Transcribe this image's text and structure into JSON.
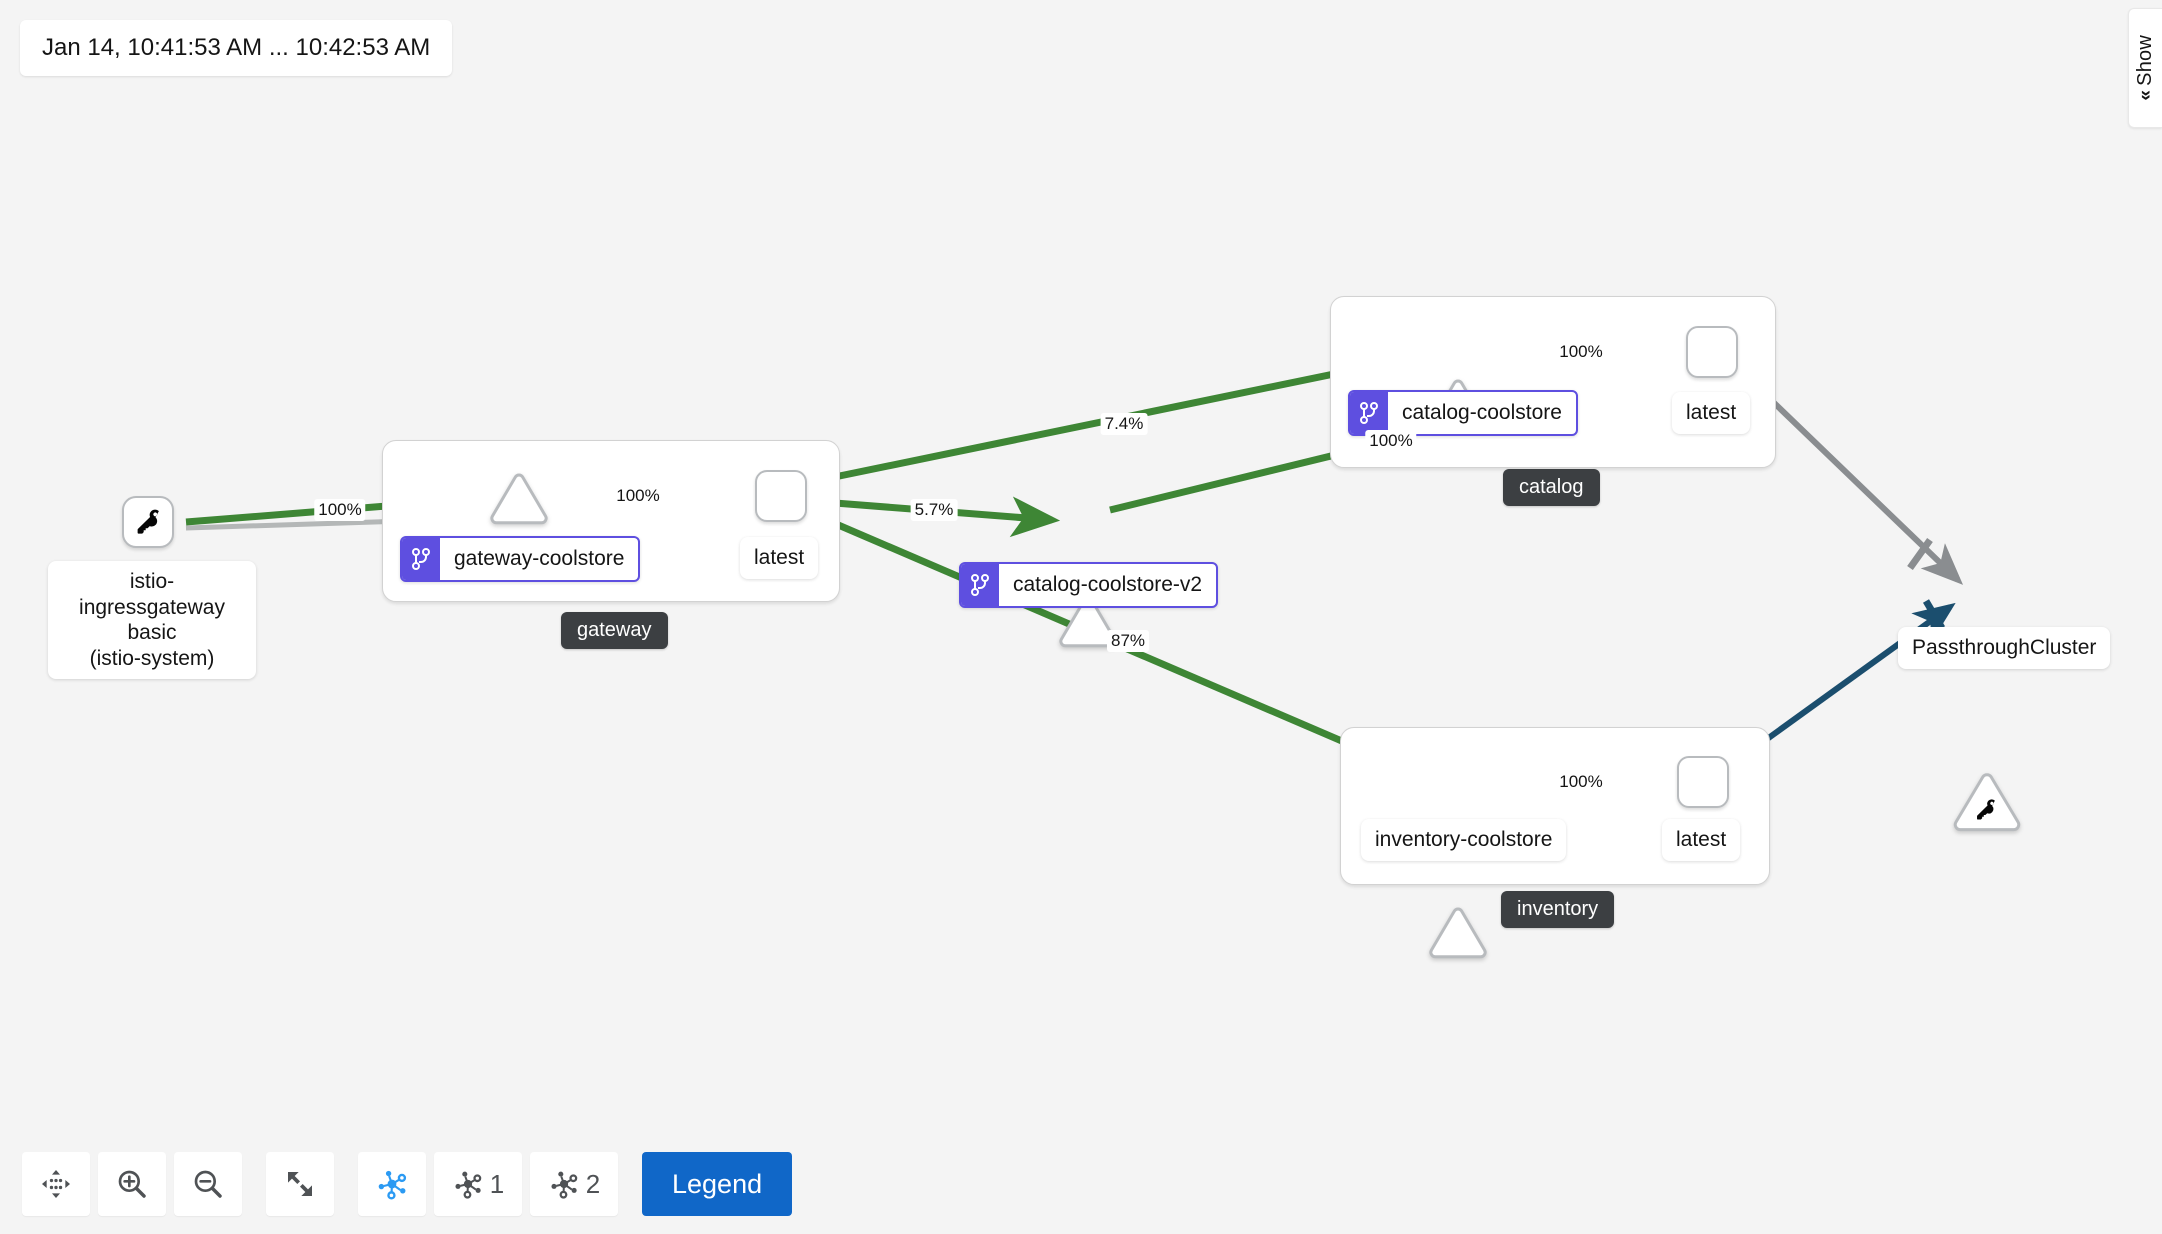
{
  "time_range": {
    "label": "Jan 14, 10:41:53 AM ... 10:42:53 AM"
  },
  "side_panel": {
    "show_label": "Show",
    "chevron": "«",
    "chevron_icon": "double-chevron-left-icon"
  },
  "colors": {
    "healthy_edge": "#3e8635",
    "idle_edge": "#8a8d90",
    "tcp_edge": "#1b4e6e",
    "badge_purple": "#5e4fe0",
    "group_badge_bg": "#3c3f42",
    "legend_blue": "#1067c8",
    "node_border": "#b8bbbe",
    "canvas_bg": "#f4f4f4",
    "active_toolbar_icon": "#2b9af3"
  },
  "groups": [
    {
      "id": "gateway",
      "label": "gateway"
    },
    {
      "id": "catalog",
      "label": "catalog"
    },
    {
      "id": "inventory",
      "label": "inventory"
    }
  ],
  "nodes": [
    {
      "id": "ingress",
      "type": "key-square",
      "icon": "key-icon",
      "label": "istio-ingressgateway\nbasic\n(istio-system)",
      "label_lines": [
        "istio-ingressgateway",
        "basic",
        "(istio-system)"
      ],
      "group": null
    },
    {
      "id": "gw-svc",
      "type": "service-triangle",
      "label": "gateway-coolstore",
      "badged": true,
      "badge_icon": "code-branch-icon",
      "group": "gateway"
    },
    {
      "id": "gw-latest",
      "type": "app-square",
      "label": "latest",
      "badged": false,
      "group": "gateway"
    },
    {
      "id": "cat-svc",
      "type": "service-triangle",
      "label": "catalog-coolstore",
      "badged": true,
      "badge_icon": "code-branch-icon",
      "group": "catalog"
    },
    {
      "id": "cat-latest",
      "type": "app-square",
      "label": "latest",
      "badged": false,
      "group": "catalog"
    },
    {
      "id": "cat-v2-svc",
      "type": "service-triangle",
      "label": "catalog-coolstore-v2",
      "badged": true,
      "badge_icon": "code-branch-icon",
      "group": null
    },
    {
      "id": "inv-svc",
      "type": "service-triangle",
      "label": "inventory-coolstore",
      "badged": false,
      "group": "inventory"
    },
    {
      "id": "inv-latest",
      "type": "app-square",
      "label": "latest",
      "badged": false,
      "group": "inventory"
    },
    {
      "id": "passthrough",
      "type": "key-triangle",
      "icon": "key-icon",
      "label": "PassthroughCluster",
      "badged": false,
      "group": null
    }
  ],
  "edges": [
    {
      "from": "ingress",
      "to": "gw-svc",
      "label": "100%",
      "status": "healthy"
    },
    {
      "from": "gw-svc",
      "to": "gw-latest",
      "label": "100%",
      "status": "healthy"
    },
    {
      "from": "gw-latest",
      "to": "cat-svc",
      "label": "7.4%",
      "status": "healthy"
    },
    {
      "from": "gw-latest",
      "to": "cat-v2-svc",
      "label": "5.7%",
      "status": "healthy"
    },
    {
      "from": "gw-latest",
      "to": "inv-svc",
      "label": "87%",
      "status": "healthy"
    },
    {
      "from": "cat-svc",
      "to": "cat-latest",
      "label": "100%",
      "status": "healthy"
    },
    {
      "from": "cat-v2-svc",
      "to": "cat-latest",
      "label": "100%",
      "status": "healthy"
    },
    {
      "from": "inv-svc",
      "to": "inv-latest",
      "label": "100%",
      "status": "healthy"
    },
    {
      "from": "cat-latest",
      "to": "passthrough",
      "label": "",
      "status": "idle"
    },
    {
      "from": "inv-latest",
      "to": "passthrough",
      "label": "",
      "status": "tcp"
    }
  ],
  "toolbar": {
    "buttons": [
      {
        "id": "drag",
        "icon": "drag-move-icon",
        "label": "",
        "active": false
      },
      {
        "id": "zoom-in",
        "icon": "zoom-in-icon",
        "label": "",
        "active": false
      },
      {
        "id": "zoom-out",
        "icon": "zoom-out-icon",
        "label": "",
        "active": false
      },
      {
        "id": "fit",
        "icon": "expand-arrows-icon",
        "label": "",
        "active": false
      },
      {
        "id": "layout-dflt",
        "icon": "topology-icon",
        "label": "",
        "active": true
      },
      {
        "id": "layout-1",
        "icon": "topology-icon",
        "label": "1",
        "active": false
      },
      {
        "id": "layout-2",
        "icon": "topology-icon",
        "label": "2",
        "active": false
      }
    ],
    "legend_label": "Legend"
  }
}
